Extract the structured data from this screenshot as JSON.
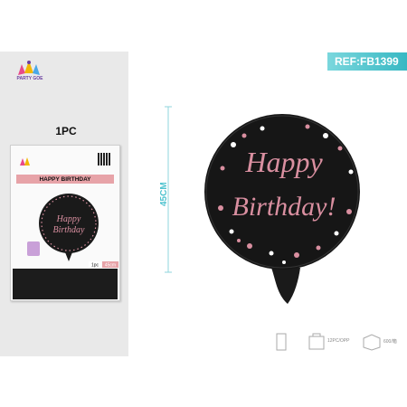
{
  "brand": {
    "name": "PARTY GOE",
    "accent": "#6b3fa0"
  },
  "reference": {
    "label": "REF:FB1399",
    "color": "#38b8c3"
  },
  "quantity": {
    "label": "1PC"
  },
  "package": {
    "title": "HAPPY BIRTHDAY",
    "balloon_text_line1": "Happy",
    "balloon_text_line2": "Birthday",
    "pc_badge": "1pc",
    "size_badge": "45cm"
  },
  "product": {
    "text_line1": "Happy",
    "text_line2": "Birthday!",
    "size_label": "45CM",
    "balloon_color": "#161616",
    "lettering_color": "#d98fa0"
  },
  "icons": {
    "packing": "12PC/OPP",
    "carton": "600/箱"
  }
}
